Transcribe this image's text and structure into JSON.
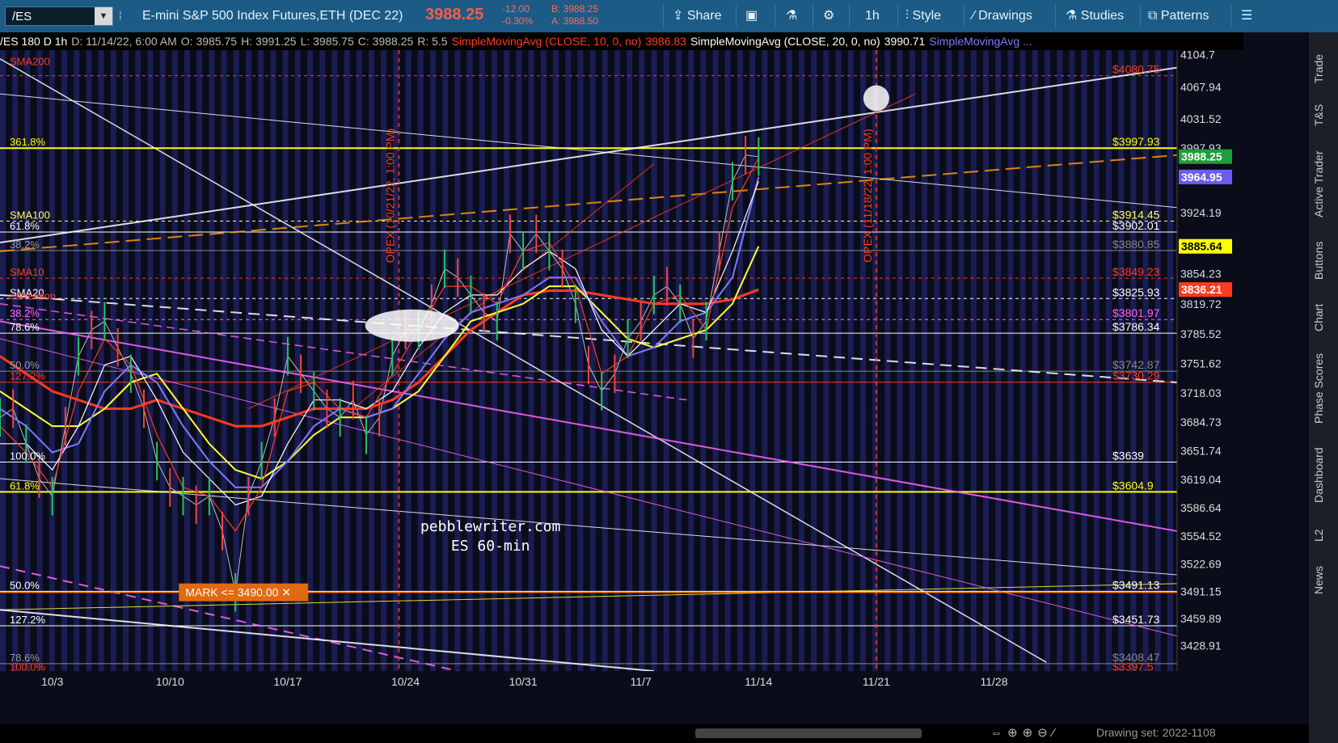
{
  "toolbar": {
    "symbol": "/ES",
    "description": "E-mini S&P 500 Index Futures,ETH (DEC 22)",
    "last_price": "3988.25",
    "change": "-12.00",
    "change_pct": "-0.30%",
    "bid": "B: 3988.25",
    "ask": "A: 3988.50",
    "share": "Share",
    "timeframe": "1h",
    "style": "Style",
    "drawings": "Drawings",
    "studies": "Studies",
    "patterns": "Patterns"
  },
  "infobar": {
    "title": "/ES 180 D 1h",
    "date": "D: 11/14/22, 6:00 AM",
    "open": "O: 3985.75",
    "high": "H: 3991.25",
    "low": "L: 3985.75",
    "close": "C: 3988.25",
    "range": "R: 5.5",
    "sma10_label": "SimpleMovingAvg (CLOSE, 10, 0, no)",
    "sma10_value": "3986.83",
    "sma20_label": "SimpleMovingAvg (CLOSE, 20, 0, no)",
    "sma20_value": "3990.71",
    "sma_more": "SimpleMovingAvg ..."
  },
  "sidebar": [
    "Trade",
    "T&S",
    "Active Trader",
    "Buttons",
    "Chart",
    "Phase Scores",
    "Dashboard",
    "L2",
    "News"
  ],
  "bottom": {
    "drawing_set": "Drawing set: 2022-1108"
  },
  "colors": {
    "sma10": "#ff3b1e",
    "sma20": "#ffffff",
    "sma50": "#7b7bff",
    "sma100": "#ffff33",
    "fib": "#ffff00",
    "pink": "#ff66ff",
    "orange": "#ff7a00"
  },
  "chart_data": {
    "type": "line",
    "ylim": [
      3400,
      4110
    ],
    "xlim": [
      10,
      190
    ],
    "x_ticks": [
      {
        "x": 18,
        "label": "10/3"
      },
      {
        "x": 36,
        "label": "10/10"
      },
      {
        "x": 54,
        "label": "10/17"
      },
      {
        "x": 72,
        "label": "10/24"
      },
      {
        "x": 90,
        "label": "10/31"
      },
      {
        "x": 108,
        "label": "11/7"
      },
      {
        "x": 126,
        "label": "11/14"
      },
      {
        "x": 144,
        "label": "11/21"
      },
      {
        "x": 162,
        "label": "11/28"
      }
    ],
    "y_ticks": [
      "4104.7",
      "4067.94",
      "4031.52",
      "3997.93",
      "3924.19",
      "3854.23",
      "3819.72",
      "3785.52",
      "3751.62",
      "3718.03",
      "3684.73",
      "3651.74",
      "3619.04",
      "3586.64",
      "3554.52",
      "3522.69",
      "3491.15",
      "3459.89",
      "3428.91"
    ],
    "price_series": [
      [
        10,
        3690
      ],
      [
        12,
        3700
      ],
      [
        14,
        3660
      ],
      [
        16,
        3620
      ],
      [
        18,
        3600
      ],
      [
        20,
        3680
      ],
      [
        22,
        3760
      ],
      [
        24,
        3790
      ],
      [
        26,
        3800
      ],
      [
        28,
        3770
      ],
      [
        30,
        3740
      ],
      [
        32,
        3700
      ],
      [
        34,
        3640
      ],
      [
        36,
        3610
      ],
      [
        38,
        3600
      ],
      [
        40,
        3590
      ],
      [
        42,
        3600
      ],
      [
        44,
        3560
      ],
      [
        46,
        3490
      ],
      [
        48,
        3600
      ],
      [
        50,
        3640
      ],
      [
        52,
        3690
      ],
      [
        54,
        3760
      ],
      [
        56,
        3740
      ],
      [
        58,
        3720
      ],
      [
        60,
        3700
      ],
      [
        62,
        3690
      ],
      [
        64,
        3710
      ],
      [
        66,
        3670
      ],
      [
        68,
        3690
      ],
      [
        70,
        3760
      ],
      [
        72,
        3790
      ],
      [
        74,
        3790
      ],
      [
        76,
        3820
      ],
      [
        78,
        3860
      ],
      [
        80,
        3850
      ],
      [
        82,
        3830
      ],
      [
        84,
        3810
      ],
      [
        86,
        3800
      ],
      [
        88,
        3900
      ],
      [
        90,
        3880
      ],
      [
        92,
        3900
      ],
      [
        94,
        3880
      ],
      [
        96,
        3860
      ],
      [
        98,
        3820
      ],
      [
        100,
        3750
      ],
      [
        102,
        3720
      ],
      [
        104,
        3740
      ],
      [
        106,
        3780
      ],
      [
        108,
        3800
      ],
      [
        110,
        3830
      ],
      [
        112,
        3840
      ],
      [
        114,
        3820
      ],
      [
        116,
        3780
      ],
      [
        118,
        3800
      ],
      [
        120,
        3880
      ],
      [
        122,
        3960
      ],
      [
        124,
        3990
      ],
      [
        126,
        3988.25
      ]
    ],
    "sma10": [
      [
        10,
        3680
      ],
      [
        14,
        3650
      ],
      [
        18,
        3610
      ],
      [
        22,
        3720
      ],
      [
        26,
        3780
      ],
      [
        30,
        3750
      ],
      [
        34,
        3670
      ],
      [
        38,
        3610
      ],
      [
        42,
        3600
      ],
      [
        46,
        3560
      ],
      [
        50,
        3610
      ],
      [
        54,
        3720
      ],
      [
        58,
        3730
      ],
      [
        62,
        3700
      ],
      [
        66,
        3690
      ],
      [
        70,
        3740
      ],
      [
        74,
        3790
      ],
      [
        78,
        3840
      ],
      [
        82,
        3840
      ],
      [
        86,
        3820
      ],
      [
        90,
        3880
      ],
      [
        94,
        3890
      ],
      [
        98,
        3840
      ],
      [
        102,
        3740
      ],
      [
        106,
        3760
      ],
      [
        110,
        3820
      ],
      [
        114,
        3830
      ],
      [
        118,
        3790
      ],
      [
        122,
        3930
      ],
      [
        126,
        3986.83
      ]
    ],
    "sma20": [
      [
        10,
        3660
      ],
      [
        14,
        3660
      ],
      [
        18,
        3630
      ],
      [
        22,
        3680
      ],
      [
        26,
        3750
      ],
      [
        30,
        3760
      ],
      [
        34,
        3710
      ],
      [
        38,
        3650
      ],
      [
        42,
        3620
      ],
      [
        46,
        3590
      ],
      [
        50,
        3600
      ],
      [
        54,
        3660
      ],
      [
        58,
        3710
      ],
      [
        62,
        3710
      ],
      [
        66,
        3700
      ],
      [
        70,
        3720
      ],
      [
        74,
        3770
      ],
      [
        78,
        3810
      ],
      [
        82,
        3830
      ],
      [
        86,
        3830
      ],
      [
        90,
        3860
      ],
      [
        94,
        3880
      ],
      [
        98,
        3860
      ],
      [
        102,
        3790
      ],
      [
        106,
        3760
      ],
      [
        110,
        3790
      ],
      [
        114,
        3820
      ],
      [
        118,
        3810
      ],
      [
        122,
        3880
      ],
      [
        126,
        3960
      ]
    ],
    "sma50": [
      [
        10,
        3700
      ],
      [
        14,
        3680
      ],
      [
        18,
        3650
      ],
      [
        22,
        3660
      ],
      [
        26,
        3720
      ],
      [
        30,
        3750
      ],
      [
        34,
        3730
      ],
      [
        38,
        3680
      ],
      [
        42,
        3640
      ],
      [
        46,
        3610
      ],
      [
        50,
        3610
      ],
      [
        54,
        3640
      ],
      [
        58,
        3680
      ],
      [
        62,
        3700
      ],
      [
        66,
        3690
      ],
      [
        70,
        3700
      ],
      [
        74,
        3740
      ],
      [
        78,
        3780
      ],
      [
        82,
        3810
      ],
      [
        86,
        3820
      ],
      [
        90,
        3830
      ],
      [
        94,
        3850
      ],
      [
        98,
        3850
      ],
      [
        102,
        3800
      ],
      [
        106,
        3760
      ],
      [
        110,
        3770
      ],
      [
        114,
        3800
      ],
      [
        118,
        3810
      ],
      [
        122,
        3850
      ],
      [
        126,
        3964.95
      ]
    ],
    "sma100": [
      [
        10,
        3720
      ],
      [
        14,
        3700
      ],
      [
        18,
        3680
      ],
      [
        22,
        3680
      ],
      [
        26,
        3700
      ],
      [
        30,
        3730
      ],
      [
        34,
        3740
      ],
      [
        38,
        3700
      ],
      [
        42,
        3660
      ],
      [
        46,
        3630
      ],
      [
        50,
        3620
      ],
      [
        54,
        3640
      ],
      [
        58,
        3670
      ],
      [
        62,
        3690
      ],
      [
        66,
        3690
      ],
      [
        70,
        3700
      ],
      [
        74,
        3720
      ],
      [
        78,
        3760
      ],
      [
        82,
        3800
      ],
      [
        86,
        3810
      ],
      [
        90,
        3820
      ],
      [
        94,
        3840
      ],
      [
        98,
        3840
      ],
      [
        102,
        3810
      ],
      [
        106,
        3780
      ],
      [
        110,
        3770
      ],
      [
        114,
        3780
      ],
      [
        118,
        3790
      ],
      [
        122,
        3820
      ],
      [
        126,
        3885.64
      ]
    ],
    "sma200": [
      [
        10,
        3760
      ],
      [
        14,
        3740
      ],
      [
        18,
        3720
      ],
      [
        22,
        3710
      ],
      [
        26,
        3700
      ],
      [
        30,
        3700
      ],
      [
        34,
        3710
      ],
      [
        38,
        3700
      ],
      [
        42,
        3690
      ],
      [
        46,
        3680
      ],
      [
        50,
        3680
      ],
      [
        54,
        3690
      ],
      [
        58,
        3700
      ],
      [
        62,
        3700
      ],
      [
        66,
        3700
      ],
      [
        70,
        3710
      ],
      [
        74,
        3730
      ],
      [
        78,
        3760
      ],
      [
        82,
        3790
      ],
      [
        86,
        3810
      ],
      [
        90,
        3830
      ],
      [
        94,
        3835
      ],
      [
        98,
        3835
      ],
      [
        102,
        3830
      ],
      [
        106,
        3825
      ],
      [
        110,
        3820
      ],
      [
        114,
        3820
      ],
      [
        118,
        3820
      ],
      [
        122,
        3825
      ],
      [
        126,
        3836.21
      ]
    ],
    "horizontal_levels": [
      {
        "price": 4080.75,
        "label": "$4080.75",
        "style": "dotted",
        "color": "#ff3b1e"
      },
      {
        "price": 3997.93,
        "label": "$3997.93",
        "style": "solid",
        "color": "#ffff00"
      },
      {
        "price": 3914.45,
        "label": "$3914.45",
        "style": "dotted",
        "color": "#ffff66"
      },
      {
        "price": 3902.01,
        "label": "$3902.01",
        "style": "solid",
        "color": "#ffffff"
      },
      {
        "price": 3880.85,
        "label": "$3880.85",
        "style": "solid",
        "color": "#888888"
      },
      {
        "price": 3849.23,
        "label": "$3849.23",
        "style": "dotted",
        "color": "#ff3b1e"
      },
      {
        "price": 3825.93,
        "label": "$3825.93",
        "style": "dotted",
        "color": "#ffffff"
      },
      {
        "price": 3801.97,
        "label": "$3801.97",
        "style": "dotted",
        "color": "#ff66ff"
      },
      {
        "price": 3786.34,
        "label": "$3786.34",
        "style": "solid",
        "color": "#ffffff"
      },
      {
        "price": 3742.87,
        "label": "$3742.87",
        "style": "solid",
        "color": "#888888"
      },
      {
        "price": 3730.29,
        "label": "$3730.29",
        "style": "solid",
        "color": "#ff3b1e"
      },
      {
        "price": 3639,
        "label": "$3639",
        "style": "solid",
        "color": "#ffffff"
      },
      {
        "price": 3604.9,
        "label": "$3604.9",
        "style": "solid",
        "color": "#ffff00"
      },
      {
        "price": 3491.13,
        "label": "$3491.13",
        "style": "solid",
        "color": "#ffffff"
      },
      {
        "price": 3451.73,
        "label": "$3451.73",
        "style": "solid",
        "color": "#ffffff"
      },
      {
        "price": 3408.47,
        "label": "$3408.47",
        "style": "solid",
        "color": "#888888"
      },
      {
        "price": 3397.5,
        "label": "$3397.5",
        "style": "solid",
        "color": "#ff3b1e"
      }
    ],
    "left_labels": [
      {
        "price": 4090,
        "label": "SMA200",
        "color": "#ff3b1e"
      },
      {
        "price": 3997.93,
        "label": "361.8%",
        "color": "#ffff00"
      },
      {
        "price": 3914.45,
        "label": "SMA100",
        "color": "#ffff66"
      },
      {
        "price": 3902.01,
        "label": "61.8%",
        "color": "#ffffff"
      },
      {
        "price": 3880.85,
        "label": "38.2%",
        "color": "#999999"
      },
      {
        "price": 3849.23,
        "label": "SMA10",
        "color": "#ff3b1e"
      },
      {
        "price": 3825.93,
        "label": "SMA20",
        "color": "#ffffff"
      },
      {
        "price": 3822,
        "label": "correction",
        "color": "#ff3b1e"
      },
      {
        "price": 3801.97,
        "label": "38.2%",
        "color": "#ff66ff"
      },
      {
        "price": 3786.34,
        "label": "78.6%",
        "color": "#ffffff"
      },
      {
        "price": 3742.87,
        "label": "50.0%",
        "color": "#999999"
      },
      {
        "price": 3730.29,
        "label": "127.2%",
        "color": "#ff3b1e"
      },
      {
        "price": 3639,
        "label": "100.0%",
        "color": "#ffffff"
      },
      {
        "price": 3604.9,
        "label": "61.8%",
        "color": "#ffff00"
      },
      {
        "price": 3491.13,
        "label": "50.0%",
        "color": "#ffffff"
      },
      {
        "price": 3451.73,
        "label": "127.2%",
        "color": "#ffffff"
      },
      {
        "price": 3408.47,
        "label": "78.6%",
        "color": "#999999"
      },
      {
        "price": 3397.5,
        "label": "100.0%",
        "color": "#ff3b1e"
      }
    ],
    "price_badges": [
      {
        "price": 3988.25,
        "label": "3988.25",
        "bg": "#1e9e3a",
        "color": "#ffffff"
      },
      {
        "price": 3964.95,
        "label": "3964.95",
        "bg": "#6a5cf0",
        "color": "#ffffff"
      },
      {
        "price": 3885.64,
        "label": "3885.64",
        "bg": "#ffff00",
        "color": "#000000"
      },
      {
        "price": 3836.21,
        "label": "3836.21",
        "bg": "#ff3b1e",
        "color": "#ffffff"
      }
    ],
    "vertical_markers": [
      {
        "x": 71,
        "label": "OPEX (10/21/22, 1:00 PM)"
      },
      {
        "x": 144,
        "label": "OPEX (11/18/22, 1:00 PM)"
      }
    ],
    "mark": {
      "price": 3490,
      "label": "MARK <= 3490.00 ✕"
    },
    "watermark": [
      "pebblewriter.com",
      "ES 60-min"
    ]
  }
}
